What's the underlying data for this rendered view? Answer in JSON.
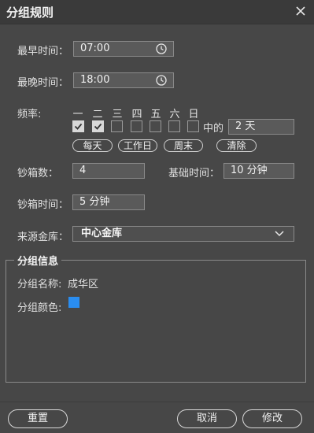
{
  "title": "分组规则",
  "earliest": {
    "label": "最早时间：",
    "value": "07:00"
  },
  "latest": {
    "label": "最晚时间：",
    "value": "18:00"
  },
  "frequency": {
    "label": "频率:",
    "days": [
      "一",
      "二",
      "三",
      "四",
      "五",
      "六",
      "日"
    ],
    "checked": [
      true,
      true,
      false,
      false,
      false,
      false,
      false
    ],
    "among_label": "中的",
    "among_value": "2 天",
    "presets": [
      "每天",
      "工作日",
      "周末",
      "清除"
    ]
  },
  "box_count": {
    "label": "钞箱数：",
    "value": "4"
  },
  "base_time": {
    "label": "基础时间：",
    "value": "10 分钟"
  },
  "box_time": {
    "label": "钞箱时间：",
    "value": "5 分钟"
  },
  "source": {
    "label": "来源金库：",
    "value": "中心金库"
  },
  "group_info": {
    "title": "分组信息",
    "name_label": "分组名称:",
    "name_value": "成华区",
    "color_label": "分组颜色:",
    "color": "#2a8df0"
  },
  "buttons": {
    "reset": "重置",
    "cancel": "取消",
    "modify": "修改"
  }
}
